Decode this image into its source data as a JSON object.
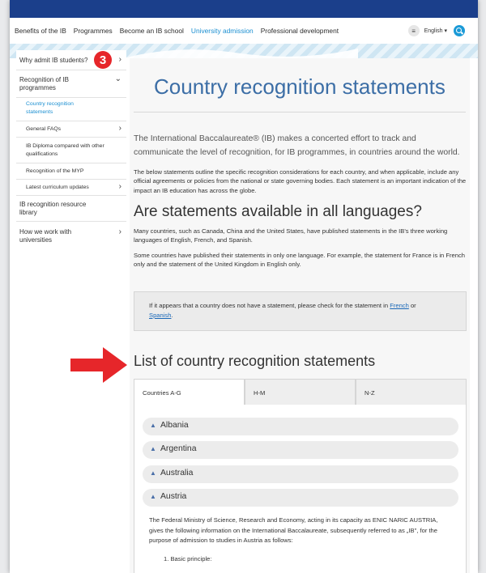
{
  "nav": {
    "items": [
      "Benefits of the IB",
      "Programmes",
      "Become an IB school",
      "University admission",
      "Professional development"
    ],
    "active": "University admission",
    "language": "English ▾"
  },
  "sidebar": {
    "items": [
      {
        "label": "Why admit IB students?",
        "chevron": "›"
      },
      {
        "label": "Recognition of IB programmes",
        "chevron": "⌄"
      },
      {
        "label": "Country recognition statements",
        "sub": true,
        "active": true
      },
      {
        "label": "General FAQs",
        "sub": true,
        "chevron": "›"
      },
      {
        "label": "IB Diploma compared with other qualifications",
        "sub": true
      },
      {
        "label": "Recognition of the MYP",
        "sub": true
      },
      {
        "label": "Latest curriculum updates",
        "sub": true,
        "chevron": "›"
      },
      {
        "label": "IB recognition resource library"
      },
      {
        "label": "How we work with universities",
        "chevron": "›"
      }
    ],
    "badge": "3"
  },
  "main": {
    "title": "Country recognition statements",
    "intro": "The International Baccalaureate® (IB) makes a concerted effort to track and communicate the level of recognition, for IB programmes, in countries around the world.",
    "para1": "The below statements outline the specific recognition considerations for each country, and when applicable, include any official agreements or policies from the national or state governing bodies.  Each statement is an important indication of the impact an IB education has across the globe.",
    "h2": "Are statements available in all languages?",
    "para2": "Many countries, such as Canada, China and the United States, have published statements in the IB's three working languages of English, French, and Spanish.",
    "para3": "Some countries have published their statements in only one language. For example, the statement for France is in French only and the statement of the United Kingdom in English only.",
    "notice_text": "If it appears that a country does not have a statement, please check for the statement in",
    "notice_link1": "French",
    "notice_or": "or",
    "notice_link2": "Spanish",
    "notice_end": ".",
    "h3": "List of country recognition statements"
  },
  "tabs": [
    "Countries A-G",
    "H-M",
    "N-Z"
  ],
  "accordion": [
    {
      "label": "Albania"
    },
    {
      "label": "Argentina"
    },
    {
      "label": "Australia"
    },
    {
      "label": "Austria",
      "expanded": true
    }
  ],
  "austria": {
    "body": "The Federal Ministry of Science, Research and Economy, acting in its capacity as ENIC NARIC AUSTRIA, gives the following information on the International Baccalaureate, subsequently referred to as „IB\", for the purpose of admission to studies in Austria as follows:",
    "list_item": "1. Basic principle:"
  }
}
